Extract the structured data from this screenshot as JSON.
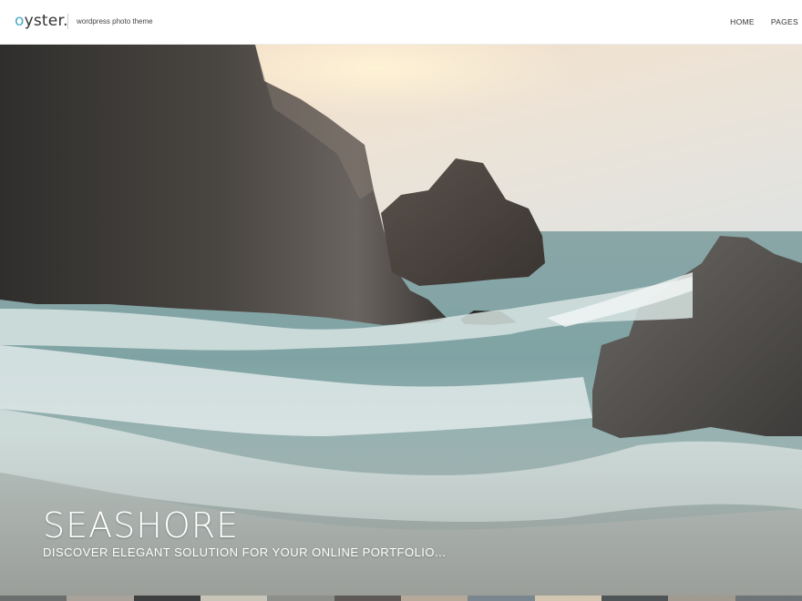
{
  "site": {
    "logo_first": "o",
    "logo_rest": "yster.",
    "tagline": "wordpress photo theme"
  },
  "nav": {
    "items": [
      "HOME",
      "PAGES"
    ]
  },
  "hero": {
    "title": "SEASHORE",
    "subtitle": "DISCOVER ELEGANT SOLUTION FOR YOUR ONLINE PORTFOLIO..."
  },
  "colors": {
    "accent": "#4aa8c9",
    "header_bg": "#ffffff",
    "text_dark": "#333333"
  },
  "thumbnails": {
    "count": 12
  }
}
